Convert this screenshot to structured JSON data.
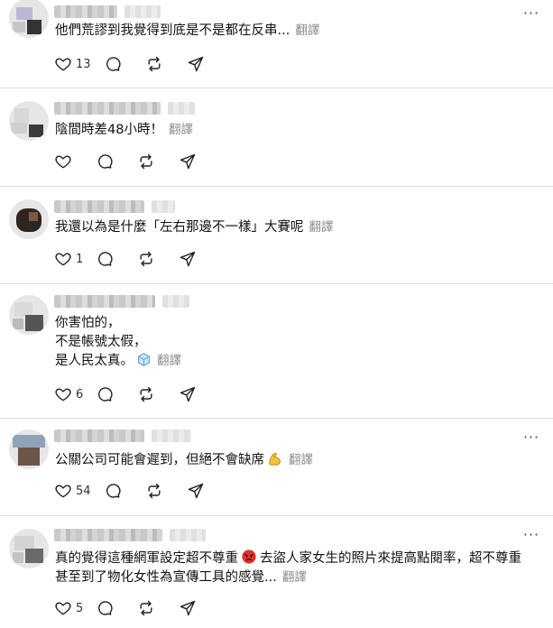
{
  "ui": {
    "translate_label": "翻譯",
    "more_label": "···"
  },
  "posts": [
    {
      "lines": [
        "他們荒謬到我覺得到底是不是都在反串..."
      ],
      "likes": "13"
    },
    {
      "lines": [
        "陰間時差48小時！"
      ],
      "likes": ""
    },
    {
      "lines": [
        "我還以為是什麼「左右那邊不一樣」大賽呢"
      ],
      "likes": "1"
    },
    {
      "lines": [
        "你害怕的，",
        "不是帳號太假，",
        "是人民太真。"
      ],
      "likes": "6",
      "emoji": "ice-cube-emoji"
    },
    {
      "lines": [
        "公關公司可能會遲到，但絕不會缺席"
      ],
      "likes": "54",
      "emoji": "flexed-biceps-emoji"
    },
    {
      "lines": [
        "真的覺得這種網軍設定超不尊重",
        "去盜人家女生的照片來提高點閱率，超不尊重",
        "甚至到了物化女性為宣傳工具的感覺..."
      ],
      "likes": "5",
      "emoji": "angry-face-emoji"
    }
  ]
}
